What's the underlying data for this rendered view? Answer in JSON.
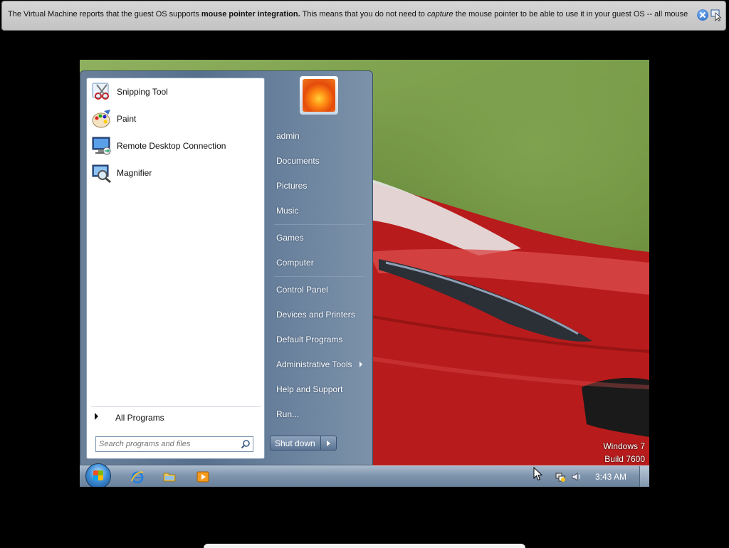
{
  "vm_notification": {
    "text_before": "The Virtual Machine reports that the guest OS supports ",
    "bold": "mouse pointer integration.",
    "text_middle": " This means that you do not need to ",
    "italic": "capture",
    "text_after": " the mouse pointer to be able to use it in your guest OS -- all mouse"
  },
  "start_menu": {
    "pinned_programs": [
      {
        "label": "Snipping Tool",
        "icon": "scissors-icon"
      },
      {
        "label": "Paint",
        "icon": "palette-icon"
      },
      {
        "label": "Remote Desktop Connection",
        "icon": "monitor-icon"
      },
      {
        "label": "Magnifier",
        "icon": "magnifier-icon"
      }
    ],
    "all_programs": "All Programs",
    "search_placeholder": "Search programs and files",
    "right_items": [
      "admin",
      "Documents",
      "Pictures",
      "Music",
      "Games",
      "Computer",
      "Control Panel",
      "Devices and Printers",
      "Default Programs",
      "Administrative Tools",
      "Help and Support",
      "Run..."
    ],
    "shutdown_label": "Shut down"
  },
  "taskbar": {
    "clock": "3:43 AM"
  },
  "watermark": {
    "line1": "Windows 7",
    "line2": "Build 7600"
  },
  "colors": {
    "start_menu_frame": "#56708e",
    "taskbar": "#7f95ad",
    "car_red": "#c41d1d"
  }
}
